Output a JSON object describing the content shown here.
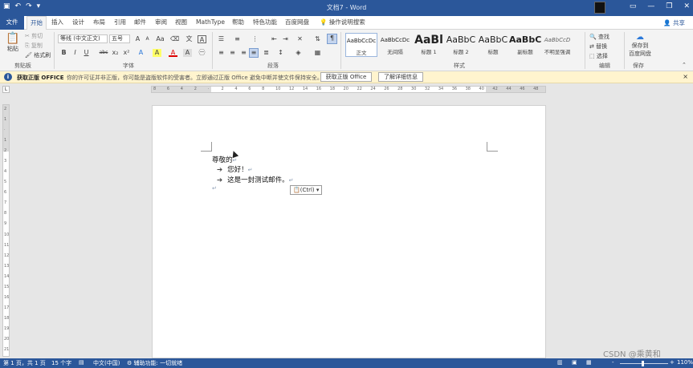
{
  "title_bar": {
    "qat_icons": [
      "save-icon",
      "undo-icon",
      "redo-icon",
      "customize-icon"
    ],
    "document_title": "文档7 - Word",
    "window_controls": [
      "ribbon-display-icon",
      "minimize-icon",
      "restore-icon",
      "close-icon"
    ]
  },
  "tabs": {
    "file": "文件",
    "items": [
      "开始",
      "插入",
      "设计",
      "布局",
      "引用",
      "邮件",
      "审阅",
      "视图",
      "MathType",
      "帮助",
      "特色功能",
      "百度网盘"
    ],
    "active": "开始",
    "tell_me": "操作说明搜索",
    "share": "共享"
  },
  "ribbon": {
    "clipboard": {
      "paste": "粘贴",
      "cut": "剪切",
      "copy": "复制",
      "format_painter": "格式刷",
      "label": "剪贴板"
    },
    "font": {
      "font_name": "等线 (中文正文)",
      "font_size": "五号",
      "label": "字体",
      "grow": "A",
      "shrink": "A",
      "case": "Aa",
      "bold": "B",
      "italic": "I",
      "underline": "U",
      "strike": "abc",
      "subscript": "x₂",
      "superscript": "x²",
      "font_color": "A",
      "highlight": "A",
      "char_a": "A"
    },
    "paragraph": {
      "label": "段落"
    },
    "styles": {
      "label": "样式",
      "items": [
        {
          "sample": "AaBbCcDc",
          "name": "正文"
        },
        {
          "sample": "AaBbCcDc",
          "name": "无间隔"
        },
        {
          "sample": "AaBl",
          "name": "标题 1"
        },
        {
          "sample": "AaBbC",
          "name": "标题 2"
        },
        {
          "sample": "AaBbC",
          "name": "标题"
        },
        {
          "sample": "AaBbC",
          "name": "副标题"
        },
        {
          "sample": "AaBbCcD",
          "name": "不明显强调"
        }
      ]
    },
    "editing": {
      "find": "查找",
      "replace": "替换",
      "select": "选择",
      "label": "编辑"
    },
    "save": {
      "save_to_cloud_line1": "保存到",
      "save_to_cloud_line2": "百度网盘",
      "label": "保存"
    }
  },
  "message_bar": {
    "title": "获取正版 OFFICE",
    "text": "你的许可证并非正版，你可能是盗版软件的受害者。立即通过正版 Office 避免中断并使文件保持安全。",
    "button_genuine": "获取正版 Office",
    "button_learn": "了解详细信息",
    "close": "×"
  },
  "ruler": {
    "corner": "L",
    "ticks": [
      "8",
      "6",
      "4",
      "2",
      "",
      "2",
      "4",
      "6",
      "8",
      "10",
      "12",
      "14",
      "16",
      "18",
      "20",
      "22",
      "24",
      "26",
      "28",
      "30",
      "32",
      "34",
      "36",
      "38",
      "40",
      "42",
      "44",
      "46",
      "48"
    ],
    "vticks": [
      "2",
      "1",
      "",
      "1",
      "2",
      "3",
      "4",
      "5",
      "6",
      "7",
      "8",
      "9",
      "10",
      "11",
      "12",
      "13",
      "14",
      "15",
      "16",
      "17",
      "18",
      "19",
      "20",
      "21"
    ]
  },
  "document": {
    "greeting": "尊敬的",
    "list_items": [
      "您好！",
      "这是一封测试邮件。"
    ],
    "paragraph_mark": "↵",
    "paste_options": "(Ctrl)"
  },
  "status_bar": {
    "page": "第 1 页，共 1 页",
    "words": "15 个字",
    "language": "中文(中国)",
    "accessibility": "辅助功能: 一切就绪",
    "zoom_minus": "-",
    "zoom_plus": "+",
    "zoom": "110%"
  },
  "watermark": "CSDN @乘黄和"
}
